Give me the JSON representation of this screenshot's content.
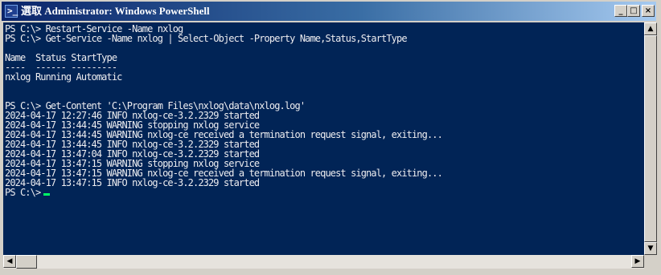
{
  "window": {
    "title": "選取 Administrator: Windows PowerShell",
    "buttons": {
      "minimize": "_",
      "maximize": "□",
      "close": "×"
    }
  },
  "console": {
    "lines": [
      "PS C:\\> Restart-Service -Name nxlog",
      "PS C:\\> Get-Service -Name nxlog | Select-Object -Property Name,Status,StartType",
      "",
      "Name  Status StartType",
      "----  ------ ---------",
      "nxlog Running Automatic",
      "",
      "",
      "PS C:\\> Get-Content 'C:\\Program Files\\nxlog\\data\\nxlog.log'",
      "2024-04-17 12:27:46 INFO nxlog-ce-3.2.2329 started",
      "2024-04-17 13:44:45 WARNING stopping nxlog service",
      "2024-04-17 13:44:45 WARNING nxlog-ce received a termination request signal, exiting...",
      "2024-04-17 13:44:45 INFO nxlog-ce-3.2.2329 started",
      "2024-04-17 13:47:04 INFO nxlog-ce-3.2.2329 started",
      "2024-04-17 13:47:15 WARNING stopping nxlog service",
      "2024-04-17 13:47:15 WARNING nxlog-ce received a termination request signal, exiting...",
      "2024-04-17 13:47:15 INFO nxlog-ce-3.2.2329 started"
    ],
    "prompt": "PS C:\\>"
  },
  "scrollbars": {
    "up": "▲",
    "down": "▼",
    "left": "◀",
    "right": "▶"
  }
}
